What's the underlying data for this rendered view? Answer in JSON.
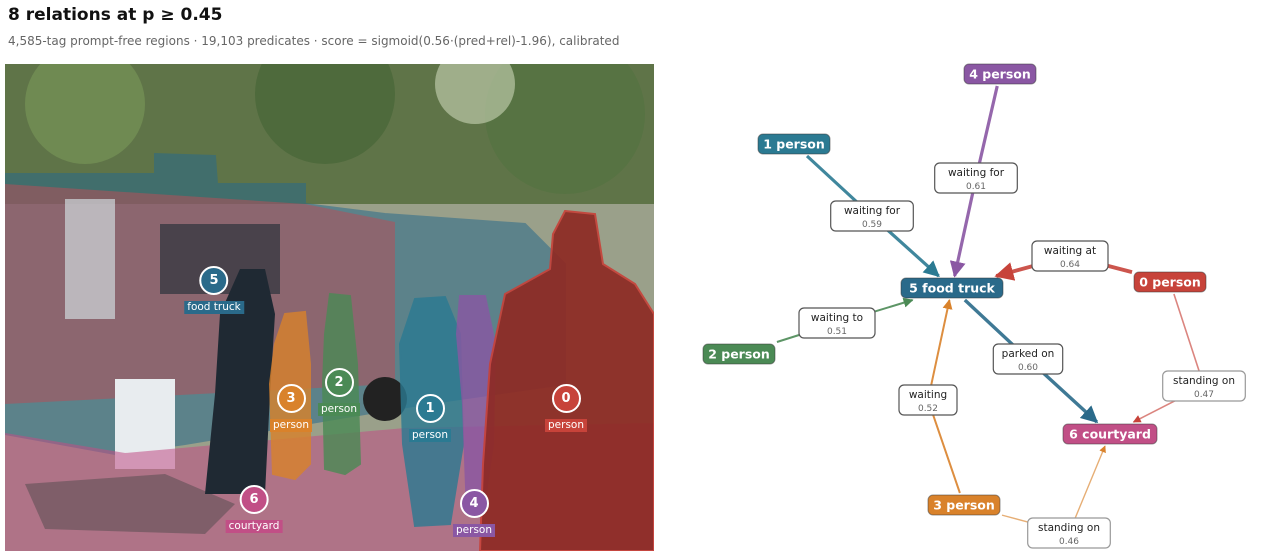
{
  "header": {
    "title": "8 relations at p ≥ 0.45",
    "subtitle": "4,585-tag prompt-free regions  ·  19,103 predicates  ·  score = sigmoid(0.56·(pred+rel)-1.96), calibrated"
  },
  "colors": {
    "person0": "#c7433a",
    "person1": "#2b7a92",
    "person2": "#4b8a55",
    "person3": "#d9822b",
    "person4": "#8a57a3",
    "food_truck": "#2a6a8a",
    "courtyard": "#c14f86"
  },
  "regions": [
    {
      "id": "0",
      "label": "person"
    },
    {
      "id": "1",
      "label": "person"
    },
    {
      "id": "2",
      "label": "person"
    },
    {
      "id": "3",
      "label": "person"
    },
    {
      "id": "4",
      "label": "person"
    },
    {
      "id": "5",
      "label": "food truck"
    },
    {
      "id": "6",
      "label": "courtyard"
    }
  ],
  "graph": {
    "nodes": [
      {
        "id": "0",
        "label": "person",
        "text": "0  person"
      },
      {
        "id": "1",
        "label": "person",
        "text": "1  person"
      },
      {
        "id": "2",
        "label": "person",
        "text": "2  person"
      },
      {
        "id": "3",
        "label": "person",
        "text": "3  person"
      },
      {
        "id": "4",
        "label": "person",
        "text": "4  person"
      },
      {
        "id": "5",
        "label": "food truck",
        "text": "5  food truck"
      },
      {
        "id": "6",
        "label": "courtyard",
        "text": "6  courtyard"
      }
    ],
    "edges": [
      {
        "from": "1",
        "to": "5",
        "predicate": "waiting for",
        "score": "0.59"
      },
      {
        "from": "4",
        "to": "5",
        "predicate": "waiting for",
        "score": "0.61"
      },
      {
        "from": "0",
        "to": "5",
        "predicate": "waiting at",
        "score": "0.64"
      },
      {
        "from": "2",
        "to": "5",
        "predicate": "waiting to",
        "score": "0.51"
      },
      {
        "from": "5",
        "to": "6",
        "predicate": "parked on",
        "score": "0.60"
      },
      {
        "from": "3",
        "to": "5",
        "predicate": "waiting",
        "score": "0.52"
      },
      {
        "from": "0",
        "to": "6",
        "predicate": "standing on",
        "score": "0.47"
      },
      {
        "from": "3",
        "to": "6",
        "predicate": "standing on",
        "score": "0.46"
      }
    ]
  }
}
